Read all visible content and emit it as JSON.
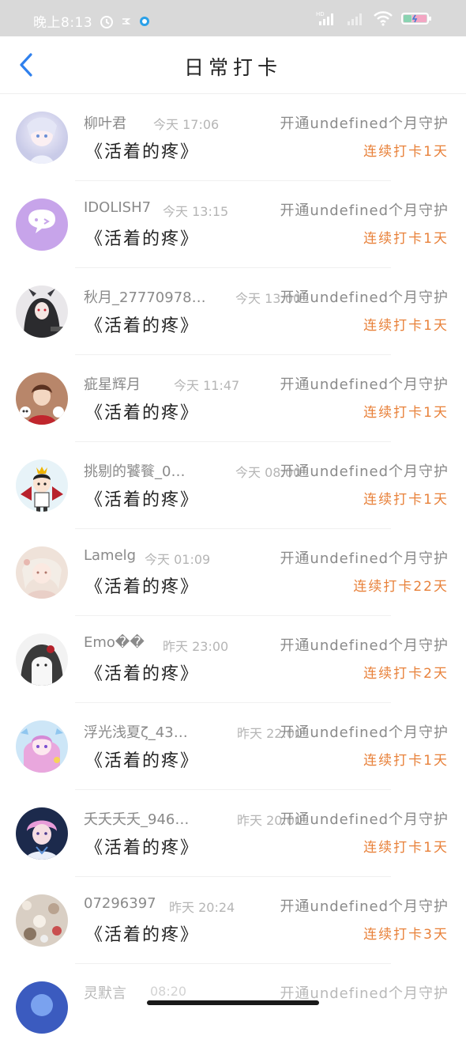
{
  "status_bar": {
    "time": "晚上8:13",
    "battery_level": 0.35,
    "icons": [
      "alarm-icon",
      "notification-icon",
      "app-icon",
      "signal-hd-icon",
      "signal-icon",
      "wifi-icon",
      "battery-icon"
    ]
  },
  "header": {
    "back_icon": "chevron-left-icon",
    "title": "日常打卡",
    "accent": "#2f80ed"
  },
  "colors": {
    "streak": "#e8813a",
    "name": "#8a8a8a",
    "time": "#b5b5b5"
  },
  "items": [
    {
      "name": "柳叶君",
      "time": "今天 17:06",
      "guard": "开通undefined个月守护",
      "post": "《活着的疼》",
      "streak": "连续打卡1天",
      "avatar": "avatar-1"
    },
    {
      "name": "IDOLISH7",
      "time": "今天 13:15",
      "guard": "开通undefined个月守护",
      "post": "《活着的疼》",
      "streak": "连续打卡1天",
      "avatar": "avatar-2"
    },
    {
      "name": "秋月_27770978…",
      "time": "今天 13:00",
      "guard": "开通undefined个月守护",
      "post": "《活着的疼》",
      "streak": "连续打卡1天",
      "avatar": "avatar-3"
    },
    {
      "name": "疵星辉月",
      "time": "今天 11:47",
      "guard": "开通undefined个月守护",
      "post": "《活着的疼》",
      "streak": "连续打卡1天",
      "avatar": "avatar-4"
    },
    {
      "name": "挑剔的饕餮_0…",
      "time": "今天 08:00",
      "guard": "开通undefined个月守护",
      "post": "《活着的疼》",
      "streak": "连续打卡1天",
      "avatar": "avatar-5"
    },
    {
      "name": "Lamelg",
      "time": "今天 01:09",
      "guard": "开通undefined个月守护",
      "post": "《活着的疼》",
      "streak": "连续打卡22天",
      "avatar": "avatar-6"
    },
    {
      "name": "Emo��",
      "time": "昨天 23:00",
      "guard": "开通undefined个月守护",
      "post": "《活着的疼》",
      "streak": "连续打卡2天",
      "avatar": "avatar-7"
    },
    {
      "name": "浮光浅夏ζ_43…",
      "time": "昨天 22:00",
      "guard": "开通undefined个月守护",
      "post": "《活着的疼》",
      "streak": "连续打卡1天",
      "avatar": "avatar-8"
    },
    {
      "name": "夭夭夭夭_946…",
      "time": "昨天 20:00",
      "guard": "开通undefined个月守护",
      "post": "《活着的疼》",
      "streak": "连续打卡1天",
      "avatar": "avatar-9"
    },
    {
      "name": "07296397",
      "time": "昨天 20:24",
      "guard": "开通undefined个月守护",
      "post": "《活着的疼》",
      "streak": "连续打卡3天",
      "avatar": "avatar-10"
    },
    {
      "name": "灵默言",
      "time": "08:20",
      "guard": "开通undefined个月守护",
      "post": "",
      "streak": "",
      "avatar": "avatar-11"
    }
  ]
}
